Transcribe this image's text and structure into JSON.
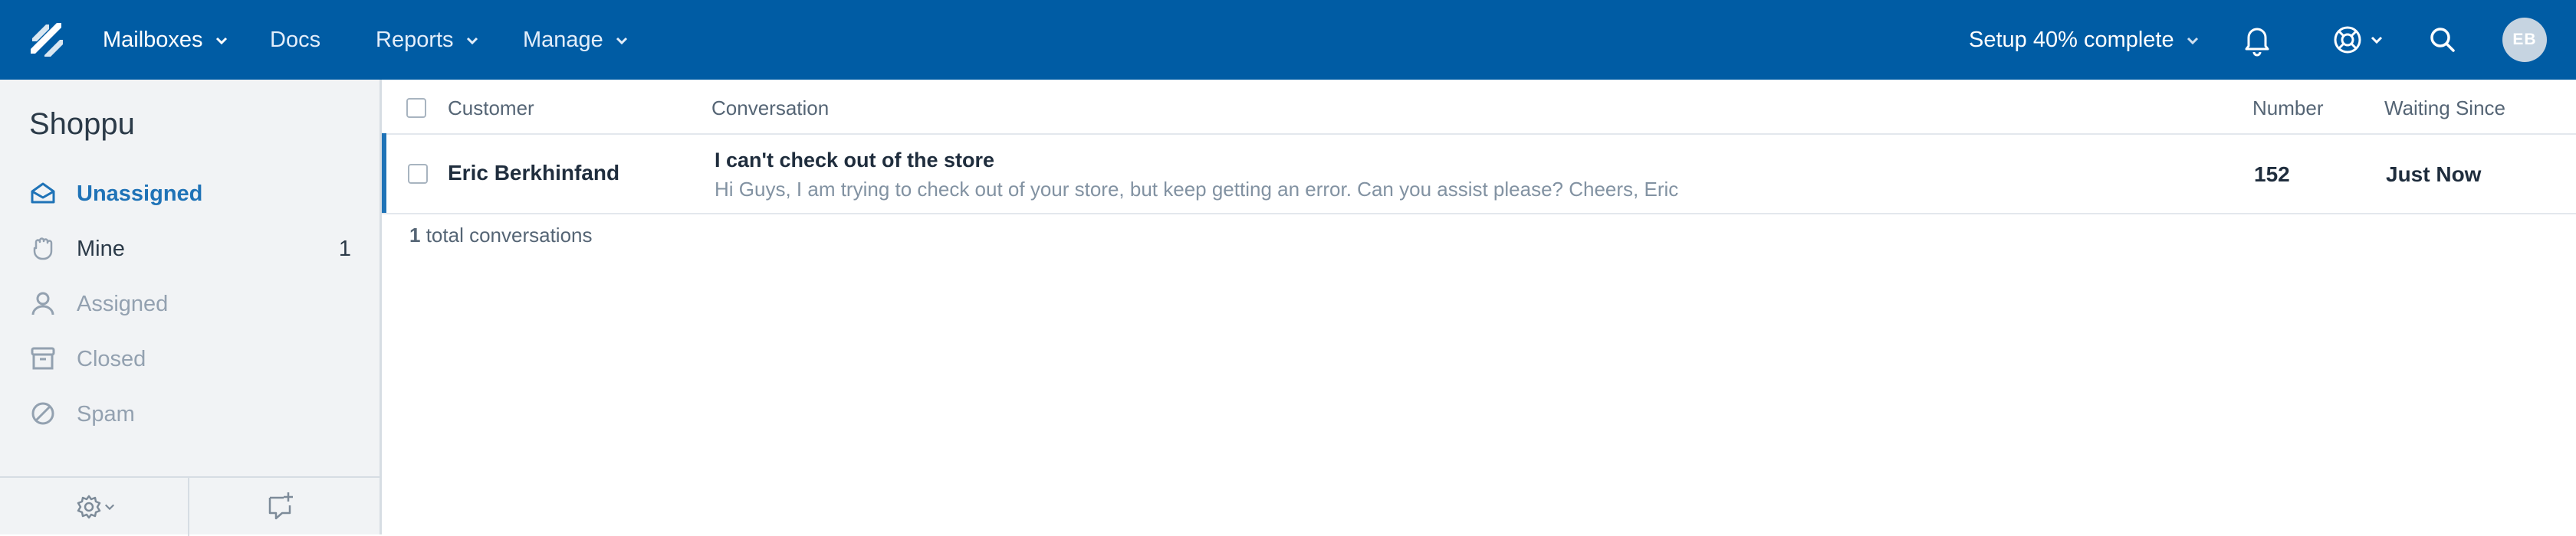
{
  "colors": {
    "topbar": "#005ca4",
    "accent": "#1f73b7",
    "sidebar_bg": "#f1f3f5"
  },
  "topbar": {
    "nav": [
      {
        "label": "Mailboxes",
        "has_caret": true
      },
      {
        "label": "Docs",
        "has_caret": false
      },
      {
        "label": "Reports",
        "has_caret": true
      },
      {
        "label": "Manage",
        "has_caret": true
      }
    ],
    "setup_label": "Setup 40% complete",
    "icons": [
      "bell-icon",
      "help-lifebuoy-icon",
      "search-icon"
    ],
    "avatar_initials": "EB"
  },
  "sidebar": {
    "title": "Shoppu",
    "items": [
      {
        "label": "Unassigned",
        "icon": "inbox-icon",
        "count": ""
      },
      {
        "label": "Mine",
        "icon": "hand-icon",
        "count": "1"
      },
      {
        "label": "Assigned",
        "icon": "person-icon",
        "count": ""
      },
      {
        "label": "Closed",
        "icon": "archive-icon",
        "count": ""
      },
      {
        "label": "Spam",
        "icon": "ban-icon",
        "count": ""
      }
    ],
    "footer_icons": [
      "gear-icon",
      "new-conversation-icon"
    ]
  },
  "list": {
    "headers": {
      "customer": "Customer",
      "conversation": "Conversation",
      "number": "Number",
      "waiting": "Waiting Since"
    },
    "rows": [
      {
        "customer": "Eric Berkhinfand",
        "subject": "I can't check out of the store",
        "preview": "Hi Guys, I am trying to check out of your store, but keep getting an error. Can you assist please? Cheers, Eric",
        "number": "152",
        "waiting": "Just Now"
      }
    ],
    "total_count": "1",
    "total_label": "total conversations"
  }
}
